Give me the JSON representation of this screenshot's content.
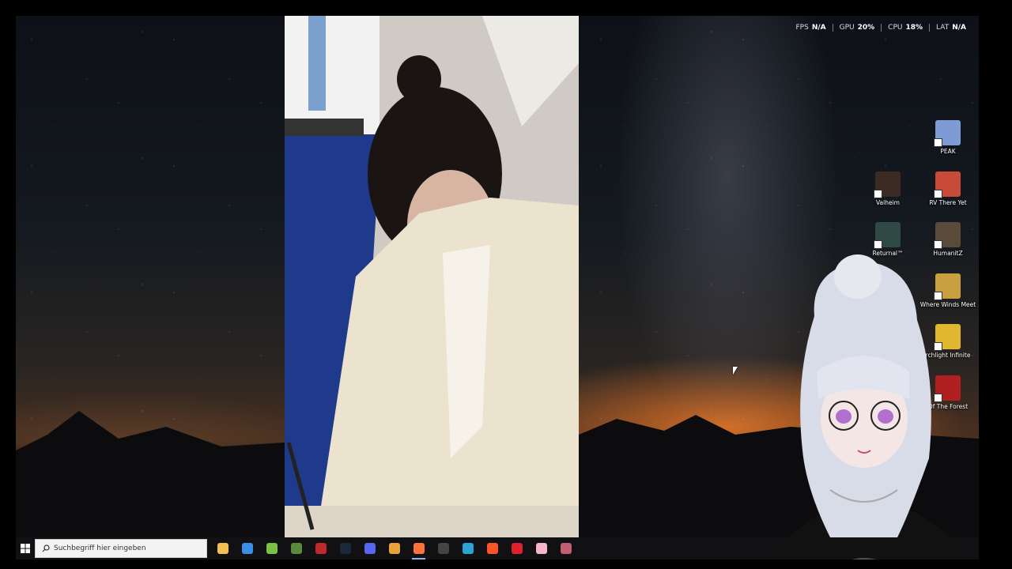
{
  "overlay": {
    "fps": {
      "label": "FPS",
      "value": "N/A"
    },
    "gpu": {
      "label": "GPU",
      "value": "20%"
    },
    "cpu": {
      "label": "CPU",
      "value": "18%"
    },
    "lat": {
      "label": "LAT",
      "value": "N/A"
    }
  },
  "desktop_icons": [
    {
      "label": "PEAK",
      "icon": "peak-icon",
      "color": "#7f9bd6"
    },
    {
      "label": "Valheim",
      "icon": "valheim-icon",
      "color": "#3b2b22"
    },
    {
      "label": "RV There Yet",
      "icon": "rv-there-yet-icon",
      "color": "#c84b3a"
    },
    {
      "label": "Returnal™",
      "icon": "returnal-icon",
      "color": "#2f4a44"
    },
    {
      "label": "HumanitZ",
      "icon": "humanitz-icon",
      "color": "#5a4a3a"
    },
    {
      "label": "Where Winds Meet",
      "icon": "where-winds-meet-icon",
      "color": "#c8a040"
    },
    {
      "label": "rchlight Infinite",
      "icon": "torchlight-infinite-icon",
      "color": "#e0b830"
    },
    {
      "label": "Of The Forest",
      "icon": "sons-of-the-forest-icon",
      "color": "#b02020"
    }
  ],
  "taskbar": {
    "search_placeholder": "Suchbegriff hier eingeben",
    "apps": [
      {
        "name": "file-explorer-icon",
        "color": "#f2c14e"
      },
      {
        "name": "store-icon",
        "color": "#3a8ee6"
      },
      {
        "name": "android-app-icon",
        "color": "#7cc242"
      },
      {
        "name": "minecraft-icon",
        "color": "#5b8a3a"
      },
      {
        "name": "game-app-icon",
        "color": "#c0282d"
      },
      {
        "name": "steam-icon",
        "color": "#1b2838"
      },
      {
        "name": "discord-icon",
        "color": "#5865f2"
      },
      {
        "name": "chrome-icon",
        "color": "#e8a33b"
      },
      {
        "name": "firefox-icon",
        "color": "#ff7139"
      },
      {
        "name": "obs-icon",
        "color": "#444444"
      },
      {
        "name": "app-icon",
        "color": "#2aa3d6"
      },
      {
        "name": "brave-icon",
        "color": "#fb542b"
      },
      {
        "name": "opera-icon",
        "color": "#e0202a"
      },
      {
        "name": "photo-app-icon",
        "color": "#f4b6c8"
      },
      {
        "name": "vtuber-app-icon",
        "color": "#c06070"
      }
    ],
    "active_app": "firefox-icon"
  }
}
